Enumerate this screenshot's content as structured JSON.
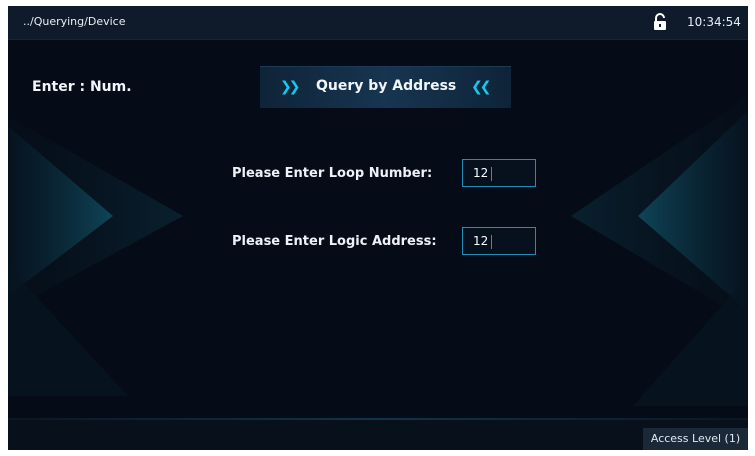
{
  "header": {
    "breadcrumb": "../Querying/Device",
    "time": "10:34:54",
    "lock_icon": "unlocked-padlock-icon"
  },
  "main": {
    "enter_label": "Enter : Num.",
    "title": "Query by Address",
    "title_left_icon": "double-chevron-right-icon",
    "title_right_icon": "double-chevron-left-icon",
    "loop_number": {
      "label": "Please Enter Loop Number:",
      "value": "12"
    },
    "logic_address": {
      "label": "Please Enter Logic Address:",
      "value": "12"
    }
  },
  "footer": {
    "access_level": "Access Level (1)"
  },
  "colors": {
    "background": "#050c17",
    "accent": "#19c6f0",
    "field_border": "#1f8fb8"
  }
}
